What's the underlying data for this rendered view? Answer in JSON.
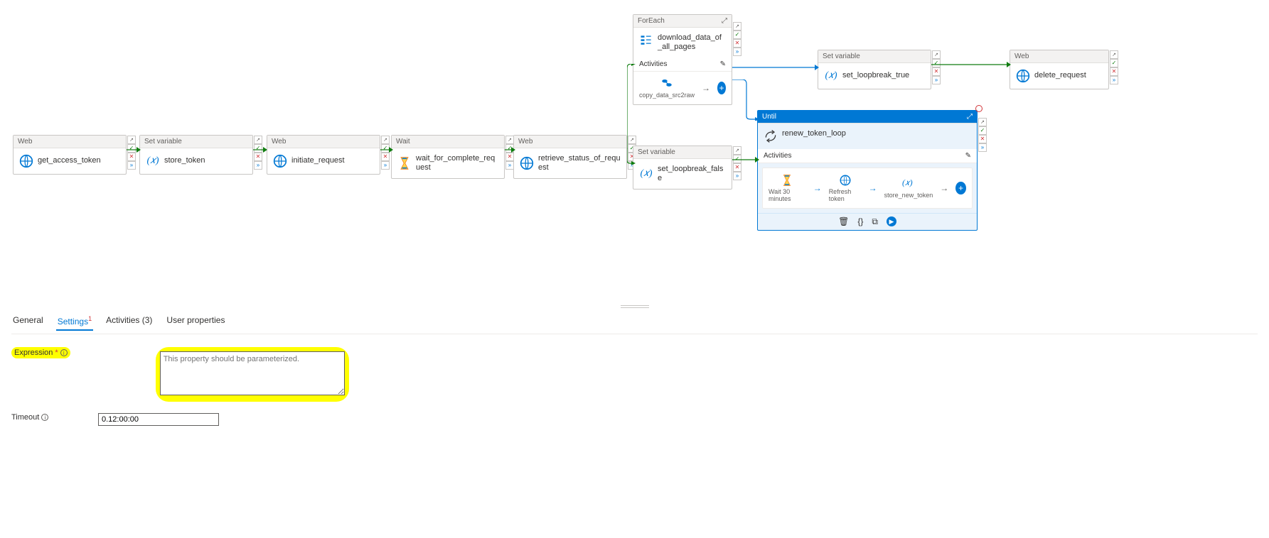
{
  "activities": {
    "a1": {
      "type": "Web",
      "name": "get_access_token"
    },
    "a2": {
      "type": "Set variable",
      "name": "store_token"
    },
    "a3": {
      "type": "Web",
      "name": "initiate_request"
    },
    "a4": {
      "type": "Wait",
      "name": "wait_for_complete_request"
    },
    "a5": {
      "type": "Web",
      "name": "retrieve_status_of_request"
    },
    "a6": {
      "type": "ForEach",
      "name": "download_data_of_all_pages",
      "activities_label": "Activities",
      "inner": [
        {
          "icon": "copy",
          "label": "copy_data_src2raw"
        }
      ]
    },
    "a7": {
      "type": "Set variable",
      "name": "set_loopbreak_false"
    },
    "a8": {
      "type": "Set variable",
      "name": "set_loopbreak_true"
    },
    "a9": {
      "type": "Web",
      "name": "delete_request"
    },
    "a10": {
      "type": "Until",
      "name": "renew_token_loop",
      "activities_label": "Activities",
      "inner": [
        {
          "icon": "wait",
          "label": "Wait 30 minutes"
        },
        {
          "icon": "web",
          "label": "Refresh token"
        },
        {
          "icon": "var",
          "label": "store_new_token"
        }
      ]
    }
  },
  "tabs": {
    "general": "General",
    "settings": "Settings",
    "settings_badge": "1",
    "activities": "Activities (3)",
    "user_props": "User properties"
  },
  "form": {
    "expression_label": "Expression",
    "expression_placeholder": "This property should be parameterized.",
    "expression_value": "",
    "timeout_label": "Timeout",
    "timeout_value": "0.12:00:00"
  }
}
